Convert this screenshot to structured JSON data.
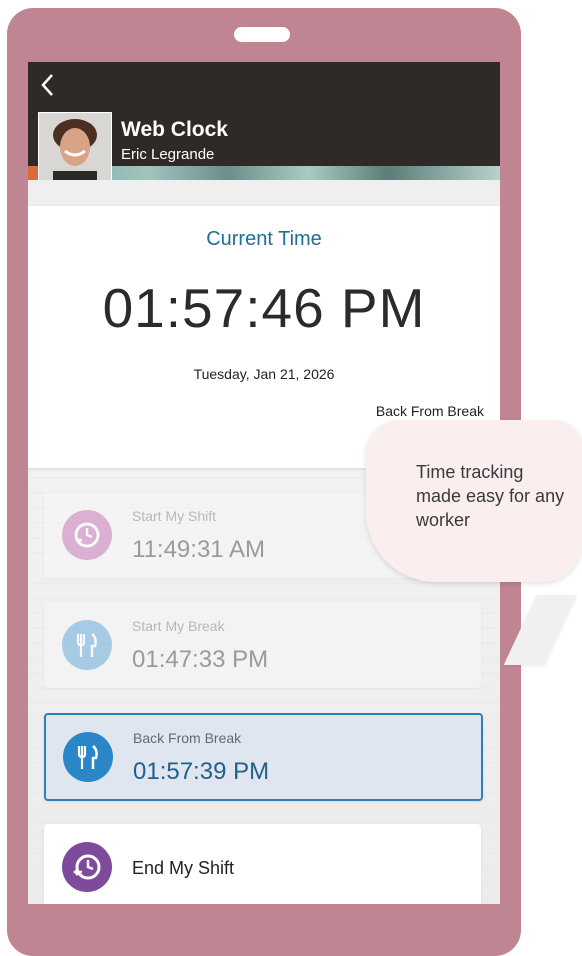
{
  "header": {
    "back_icon": "chevron-left-icon",
    "title": "Web Clock",
    "user_name": "Eric Legrande"
  },
  "time_card": {
    "label": "Current Time",
    "time": "01:57:46 PM",
    "date": "Tuesday, Jan 21, 2026",
    "status": "Back From Break"
  },
  "punches": [
    {
      "label": "Start My Shift",
      "time": "11:49:31 AM",
      "icon": "clock-in-icon",
      "color": "#c97dbb",
      "state": "done"
    },
    {
      "label": "Start My Break",
      "time": "01:47:33 PM",
      "icon": "fork-knife-icon",
      "color": "#6bb0dd",
      "state": "done"
    },
    {
      "label": "Back From Break",
      "time": "01:57:39 PM",
      "icon": "fork-knife-icon",
      "color": "#2a86c6",
      "state": "active"
    },
    {
      "label": "End My Shift",
      "icon": "clock-out-icon",
      "color": "#7d4a9c",
      "state": "pending"
    }
  ],
  "callout": {
    "text": "Time tracking made easy for any worker"
  },
  "colors": {
    "device_frame": "#c08592",
    "header_bg": "#2f2a28",
    "accent_blue": "#1f6f94"
  }
}
